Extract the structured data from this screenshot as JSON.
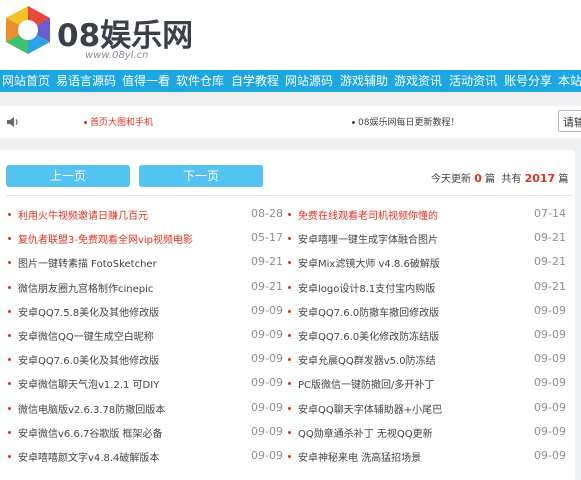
{
  "header": {
    "logo_text": "08娱乐网",
    "logo_sub": "www.08yl.cn"
  },
  "nav": {
    "items": [
      "网站首页",
      "易语言源码",
      "值得一看",
      "软件仓库",
      "自学教程",
      "网站源码",
      "游戏辅助",
      "游戏资讯",
      "活动资讯",
      "账号分享",
      "本站"
    ]
  },
  "notice": {
    "item1": "首页大图和手机",
    "item2": "08娱乐网每日更新教程！",
    "search_value": "请输"
  },
  "pager": {
    "prev_label": "上一页",
    "next_label": "下一页"
  },
  "stats": {
    "today_prefix": "今天更新",
    "today_count": "0",
    "today_unit": "篇",
    "total_prefix": "共有",
    "total_count": "2017",
    "total_unit": "篇"
  },
  "articles_left": [
    {
      "title": "利用火牛视频邀请日赚几百元",
      "date": "08-28",
      "highlight": true
    },
    {
      "title": "复仇者联盟3-免费观看全网vip视频电影",
      "date": "05-17",
      "highlight": true
    },
    {
      "title": "图片一键转素描 FotoSketcher",
      "date": "09-21",
      "highlight": false
    },
    {
      "title": "微信朋友圈九宫格制作cinepic",
      "date": "09-21",
      "highlight": false
    },
    {
      "title": "安卓QQ7.5.8美化及其他修改版",
      "date": "09-09",
      "highlight": false
    },
    {
      "title": "安卓微信QQ一键生成空白昵称",
      "date": "09-09",
      "highlight": false
    },
    {
      "title": "安卓QQ7.6.0美化及其他修改版",
      "date": "09-09",
      "highlight": false
    },
    {
      "title": "安卓微信聊天气泡v1.2.1 可DIY",
      "date": "09-09",
      "highlight": false
    },
    {
      "title": "微信电脑版v2.6.3.78防撤回版本",
      "date": "09-09",
      "highlight": false
    },
    {
      "title": "安卓微信v6.6.7谷歌版 框架必备",
      "date": "09-09",
      "highlight": false
    },
    {
      "title": "安卓嘻嘻颜文字v4.8.4破解版本",
      "date": "09-09",
      "highlight": false
    }
  ],
  "articles_right": [
    {
      "title": "免费在线观看老司机视频你懂的",
      "date": "07-14",
      "highlight": true
    },
    {
      "title": "安卓嘻哩一键生成字体融合图片",
      "date": "09-21",
      "highlight": false
    },
    {
      "title": "安卓Mix滤镜大师 v4.8.6破解版",
      "date": "09-21",
      "highlight": false
    },
    {
      "title": "安卓logo设计8.1支付宝内购版",
      "date": "09-21",
      "highlight": false
    },
    {
      "title": "安卓QQ7.6.0防撤车撤回修改版",
      "date": "09-09",
      "highlight": false
    },
    {
      "title": "安卓QQ7.6.0美化修改防冻结版",
      "date": "09-09",
      "highlight": false
    },
    {
      "title": "安卓允晨QQ群发器v5.0防冻结",
      "date": "09-09",
      "highlight": false
    },
    {
      "title": "PC版微信一键防撤回/多开补丁",
      "date": "09-09",
      "highlight": false
    },
    {
      "title": "安卓QQ聊天字体辅助器+小尾巴",
      "date": "09-09",
      "highlight": false
    },
    {
      "title": "QQ勋章通杀补丁 无视QQ更新",
      "date": "09-09",
      "highlight": false
    },
    {
      "title": "安卓神秘来电 洗高猛招场景",
      "date": "09-09",
      "highlight": false
    }
  ],
  "colors": {
    "nav_bg": "#1da7e1",
    "button_bg": "#54c3f1",
    "accent_red": "#e0321e"
  },
  "icons": [
    "logo-icon",
    "speaker-icon",
    "bullet-dot-icon"
  ]
}
